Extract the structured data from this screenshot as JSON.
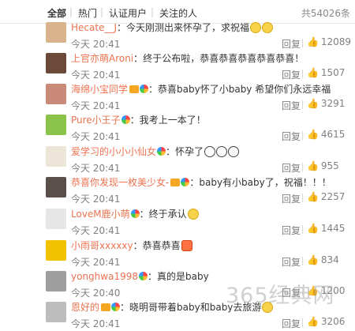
{
  "tabs": {
    "all": "全部",
    "hot": "热门",
    "verified": "认证用户",
    "followed": "关注的人",
    "total": "共54026条"
  },
  "reply_label": "回复",
  "comments": [
    {
      "user": "Hecate__J",
      "text": "今天刚测出来怀孕了，求祝福",
      "time": "今天 20:41",
      "likes": "12089",
      "emoji": [
        "smile",
        "smile"
      ],
      "avatar": "#d9b38c"
    },
    {
      "user": "上官亦萌Aroni",
      "text": "终于公布啦，恭喜恭喜恭喜恭喜恭喜！",
      "time": "今天 20:41",
      "likes": "1507",
      "emoji": [],
      "avatar": "#6b4a3a"
    },
    {
      "user": "海绵小宝同学",
      "text": "恭喜baby怀了小baby 希望你们永远幸福",
      "time": "今天 20:41",
      "likes": "3291",
      "emoji": [],
      "avatar": "#c98a7a",
      "vip": true,
      "badge": true
    },
    {
      "user": "Pure小王子",
      "text": "我考上一本了！",
      "time": "今天 20:41",
      "likes": "4615",
      "emoji": [],
      "avatar": "#8bc34a",
      "badge": true
    },
    {
      "user": "爱学习的小小小仙女",
      "text": "怀孕了",
      "time": "今天 20:41",
      "likes": "955",
      "emoji": [
        "dog",
        "dog",
        "dog"
      ],
      "avatar": "#ede6d8",
      "badge": true
    },
    {
      "user": "恭喜你发现一枚美少女-",
      "text": "baby有小baby了，祝福！！！",
      "time": "今天 20:41",
      "likes": "2257",
      "emoji": [],
      "avatar": "#5a4f4a",
      "vip": true,
      "badge": true
    },
    {
      "user": "LoveM鹿小萌",
      "text": "终于承认",
      "time": "今天 20:41",
      "likes": "1445",
      "emoji": [
        "smile"
      ],
      "avatar": "#e6e6e6",
      "badge": true
    },
    {
      "user": "小雨哥xxxxxy",
      "text": "恭喜恭喜",
      "time": "今天 20:41",
      "likes": "834",
      "emoji": [
        "fire"
      ],
      "avatar": "#f2c200"
    },
    {
      "user": "yonghwa1998",
      "text": "真的是baby",
      "time": "今天 20:40",
      "likes": "1200",
      "emoji": [],
      "avatar": "#9e9e9e",
      "badge": true
    },
    {
      "user": "恩好的",
      "text": "晓明哥带着baby和baby去旅游",
      "time": "今天 20:41",
      "likes": "3206",
      "emoji": [
        "smile"
      ],
      "avatar": "#bdbdbd",
      "vip": true,
      "badge": true
    }
  ],
  "watermark": "365经典网",
  "colors": {
    "username": "#eb7350",
    "meta": "#808080",
    "text": "#333333"
  }
}
